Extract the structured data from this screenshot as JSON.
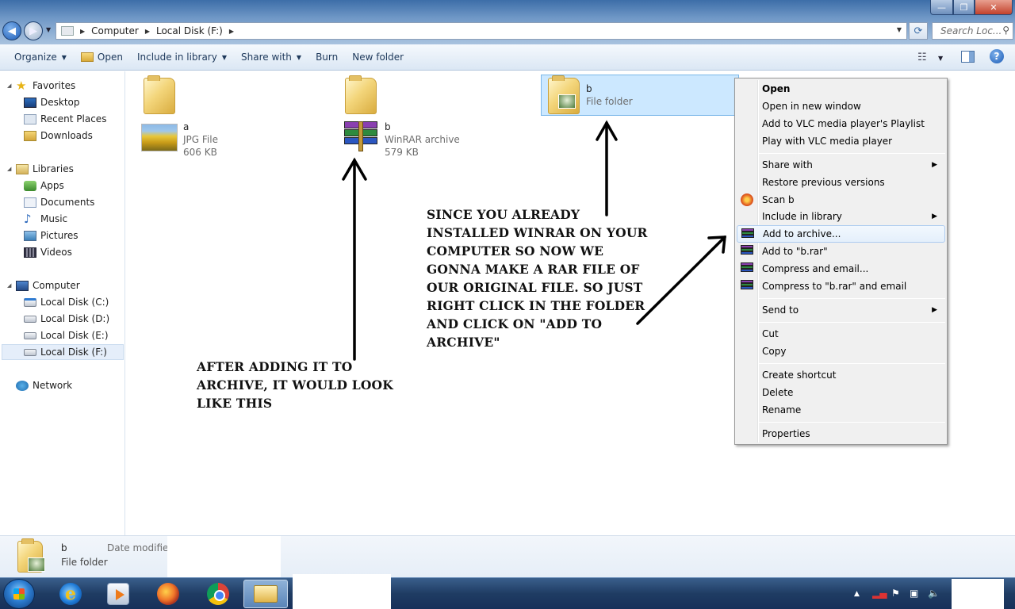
{
  "window": {
    "controls": {
      "minimize": "—",
      "maximize": "❐",
      "close": "✕"
    }
  },
  "address": {
    "segments": [
      "Computer",
      "Local Disk (F:)"
    ],
    "search_placeholder": "Search Loc..."
  },
  "commandbar": {
    "organize": "Organize",
    "open": "Open",
    "include_in_library": "Include in library",
    "share_with": "Share with",
    "burn": "Burn",
    "new_folder": "New folder"
  },
  "sidebar": {
    "favorites": {
      "label": "Favorites",
      "items": [
        "Desktop",
        "Recent Places",
        "Downloads"
      ]
    },
    "libraries": {
      "label": "Libraries",
      "items": [
        "Apps",
        "Documents",
        "Music",
        "Pictures",
        "Videos"
      ]
    },
    "computer": {
      "label": "Computer",
      "items": [
        "Local Disk (C:)",
        "Local Disk (D:)",
        "Local Disk (E:)",
        "Local Disk (F:)"
      ],
      "selected": "Local Disk (F:)"
    },
    "network": {
      "label": "Network"
    }
  },
  "files": [
    {
      "name": "a",
      "type": "JPG File",
      "size": "606 KB"
    },
    {
      "name": "b",
      "type": "WinRAR archive",
      "size": "579 KB"
    },
    {
      "name": "b",
      "type": "File folder",
      "selected": true
    }
  ],
  "context_menu": {
    "items": [
      "Open",
      "Open in new window",
      "Add to VLC media player's Playlist",
      "Play with VLC media player",
      "Share with",
      "Restore previous versions",
      "Scan b",
      "Include in library",
      "Add to archive...",
      "Add to \"b.rar\"",
      "Compress and email...",
      "Compress to \"b.rar\" and email",
      "Send to",
      "Cut",
      "Copy",
      "Create shortcut",
      "Delete",
      "Rename",
      "Properties"
    ],
    "highlighted": "Add to archive..."
  },
  "annotations": {
    "install_note": "SINCE YOU ALREADY INSTALLED WINRAR ON YOUR COMPUTER SO NOW WE GONNA MAKE A RAR FILE OF OUR ORIGINAL FILE. SO JUST RIGHT CLICK IN THE FOLDER AND CLICK ON \"ADD TO ARCHIVE\"",
    "after_note": "AFTER ADDING IT TO ARCHIVE, IT WOULD LOOK LIKE THIS"
  },
  "details_pane": {
    "name": "b",
    "type": "File folder",
    "date_label": "Date modified:"
  },
  "taskbar": {
    "apps": [
      "Internet Explorer",
      "Windows Media Player",
      "Firefox",
      "Chrome",
      "Windows Explorer"
    ]
  },
  "icons": {
    "back": "back-arrow-icon",
    "forward": "forward-arrow-icon",
    "refresh": "refresh-icon",
    "search": "search-icon",
    "help": "help-icon"
  }
}
